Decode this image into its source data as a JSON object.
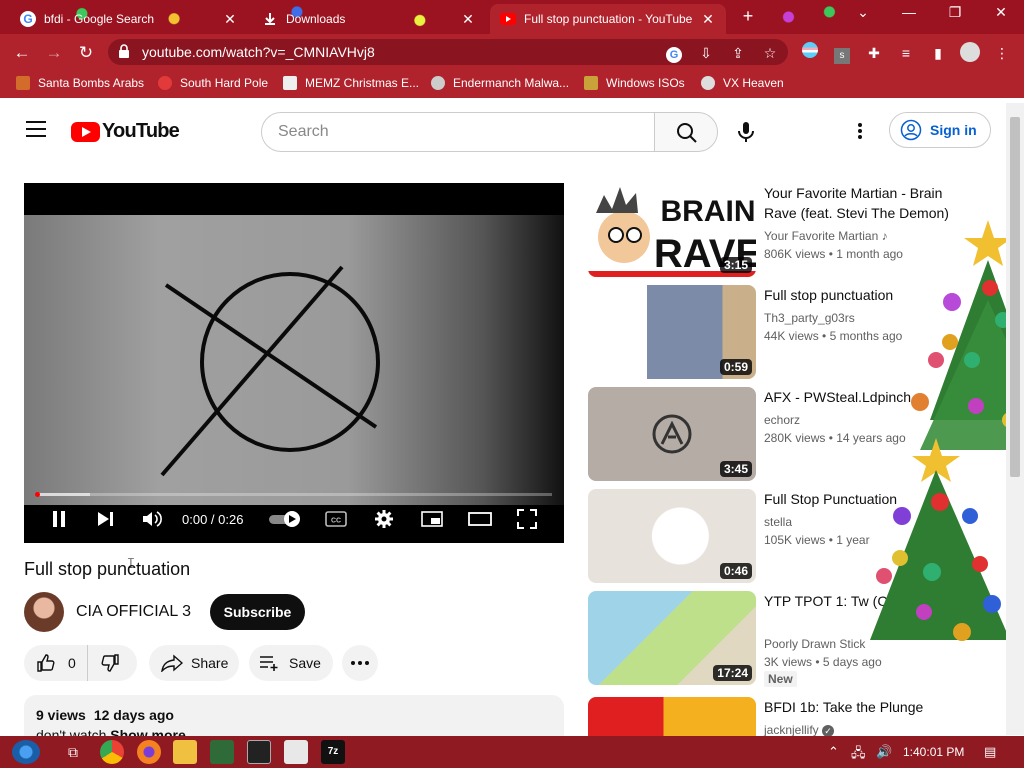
{
  "browser": {
    "tabs": [
      {
        "label": "bfdi - Google Search",
        "icon": "google-icon"
      },
      {
        "label": "Downloads",
        "icon": "download-icon"
      },
      {
        "label": "Full stop punctuation - YouTube",
        "icon": "youtube-icon",
        "active": true
      }
    ],
    "url": "youtube.com/watch?v=_CMNIAVHvj8",
    "bookmarks": [
      "Santa Bombs Arabs",
      "South Hard Pole",
      "MEMZ Christmas E...",
      "Endermanch Malwa...",
      "Windows ISOs",
      "VX Heaven"
    ],
    "theme_color": "#b0222c"
  },
  "header": {
    "logo_text": "YouTube",
    "search_placeholder": "Search",
    "signin_label": "Sign in"
  },
  "player": {
    "current_time": "0:00",
    "duration": "0:26",
    "time_display": "0:00 / 0:26",
    "progress_fraction": 0.0,
    "buffered_fraction": 0.1
  },
  "video": {
    "title": "Full stop punctuation",
    "channel": "CIA OFFICIAL 3",
    "subscribe_label": "Subscribe",
    "likes": "0",
    "share_label": "Share",
    "save_label": "Save",
    "views": "9 views",
    "age": "12 days ago",
    "description_snippet": "don't watch",
    "show_more": "Show more"
  },
  "recommendations": [
    {
      "title": "Your Favorite Martian - Brain Rave (feat. Stevi The Demon)",
      "channel": "Your Favorite Martian",
      "views": "806K views",
      "age": "1 month ago",
      "duration": "3:15",
      "thumb_text_1": "BRAIN",
      "thumb_text_2": "RAVE"
    },
    {
      "title": "Full stop punctuation",
      "channel": "Th3_party_g03rs",
      "views": "44K views",
      "age": "5 months ago",
      "duration": "0:59"
    },
    {
      "title": "AFX - PWSteal.Ldpinch",
      "channel": "echorz",
      "views": "280K views",
      "age": "14 years ago",
      "duration": "3:45"
    },
    {
      "title": "Full Stop Punctuation",
      "channel": "stella",
      "views": "105K views",
      "age": "1 year",
      "duration": "0:46"
    },
    {
      "title": "YTP TPOT 1: Tw (Collab)",
      "channel": "Poorly Drawn Stick",
      "views": "3K views",
      "age": "5 days ago",
      "duration": "17:24",
      "badge": "New"
    },
    {
      "title": "BFDI 1b: Take the Plunge",
      "channel": "jacknjellify",
      "views": "",
      "age": "",
      "duration": ""
    }
  ],
  "taskbar": {
    "time": "1:40:01 PM"
  }
}
